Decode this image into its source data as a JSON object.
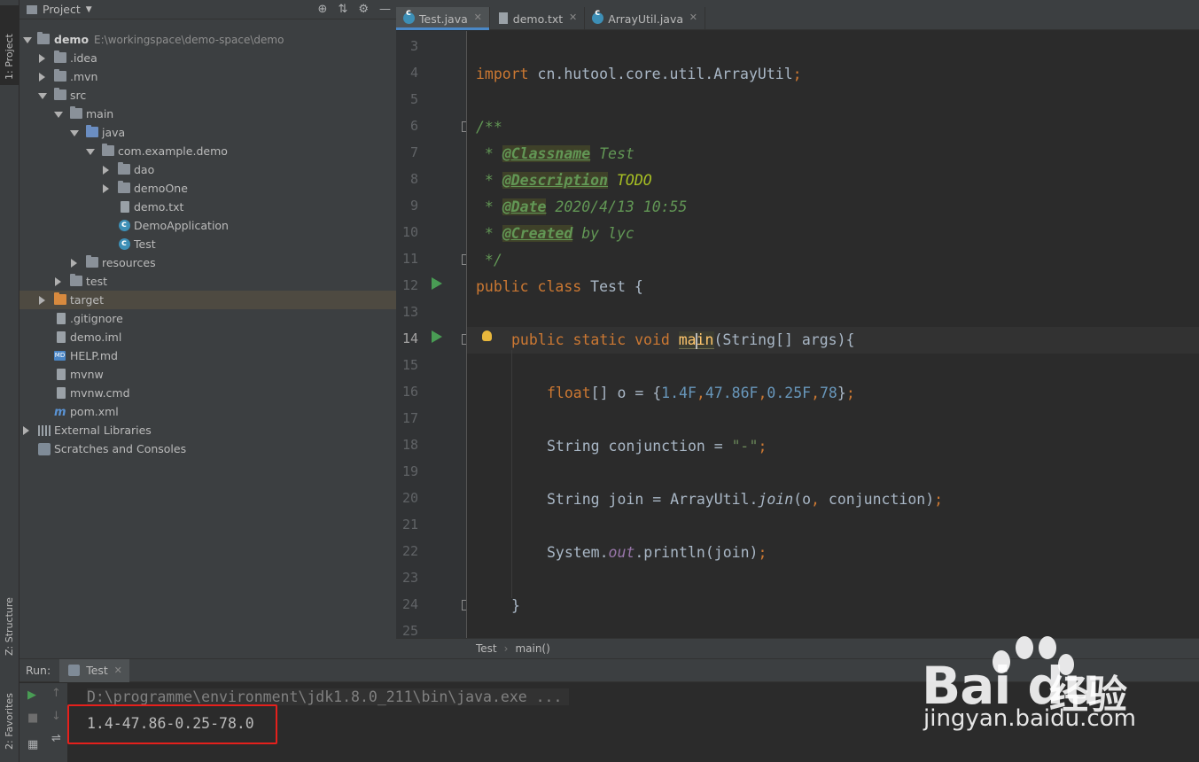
{
  "left_strip": {
    "project_tab": "1: Project",
    "structure_tab": "Z: Structure",
    "favorites_tab": "2: Favorites"
  },
  "project": {
    "title": "Project",
    "tree": [
      {
        "label": "demo",
        "path": "E:\\workingspace\\demo-space\\demo"
      },
      {
        "label": ".idea"
      },
      {
        "label": ".mvn"
      },
      {
        "label": "src"
      },
      {
        "label": "main"
      },
      {
        "label": "java"
      },
      {
        "label": "com.example.demo"
      },
      {
        "label": "dao"
      },
      {
        "label": "demoOne"
      },
      {
        "label": "demo.txt"
      },
      {
        "label": "DemoApplication"
      },
      {
        "label": "Test"
      },
      {
        "label": "resources"
      },
      {
        "label": "test"
      },
      {
        "label": "target"
      },
      {
        "label": ".gitignore"
      },
      {
        "label": "demo.iml"
      },
      {
        "label": "HELP.md"
      },
      {
        "label": "mvnw"
      },
      {
        "label": "mvnw.cmd"
      },
      {
        "label": "pom.xml"
      },
      {
        "label": "External Libraries"
      },
      {
        "label": "Scratches and Consoles"
      }
    ]
  },
  "editor": {
    "tabs": [
      "Test.java",
      "demo.txt",
      "ArrayUtil.java"
    ],
    "line_numbers": [
      "3",
      "4",
      "5",
      "6",
      "7",
      "8",
      "9",
      "10",
      "11",
      "12",
      "13",
      "14",
      "15",
      "16",
      "17",
      "18",
      "19",
      "20",
      "21",
      "22",
      "23",
      "24",
      "25"
    ],
    "code": {
      "l4_kw": "import",
      "l4_rest": " cn.hutool.core.util.ArrayUtil",
      "l6": "/**",
      "l7_star": " * ",
      "l7_tag": "@Classname",
      "l7_val": " Test",
      "l8_star": " * ",
      "l8_tag": "@Description",
      "l8_val": " TODO",
      "l9_star": " * ",
      "l9_tag": "@Date",
      "l9_val": " 2020/4/13 10:55",
      "l10_star": " * ",
      "l10_tag": "@Created",
      "l10_val": " by lyc",
      "l11": " */",
      "l12_kw": "public class",
      "l12_rest": " Test {",
      "l14_kw": "public static void",
      "l14_name_a": "ma",
      "l14_name_b": "in",
      "l14_rest": "(String[] args){",
      "l16_kw": "float",
      "l16_a": "[] o = {",
      "l16_n1": "1.4F",
      "l16_n2": "47.86F",
      "l16_n3": "0.25F",
      "l16_n4": "78",
      "l16_end": "}",
      "l18_a": "String conjunction = ",
      "l18_str": "\"-\"",
      "l20_a": "String join = ArrayUtil.",
      "l20_m": "join",
      "l20_b": "(o",
      "l20_c": " conjunction)",
      "l22_a": "System.",
      "l22_f": "out",
      "l22_b": ".println(join)",
      "l24": "}"
    },
    "breadcrumb": [
      "Test",
      "main()"
    ]
  },
  "run": {
    "label": "Run:",
    "tab": "Test",
    "command": "D:\\programme\\environment\\jdk1.8.0_211\\bin\\java.exe ...",
    "output": "1.4-47.86-0.25-78.0"
  },
  "watermark": {
    "logo": "Bai  du",
    "cn": "经验",
    "url": "jingyan.baidu.com"
  }
}
